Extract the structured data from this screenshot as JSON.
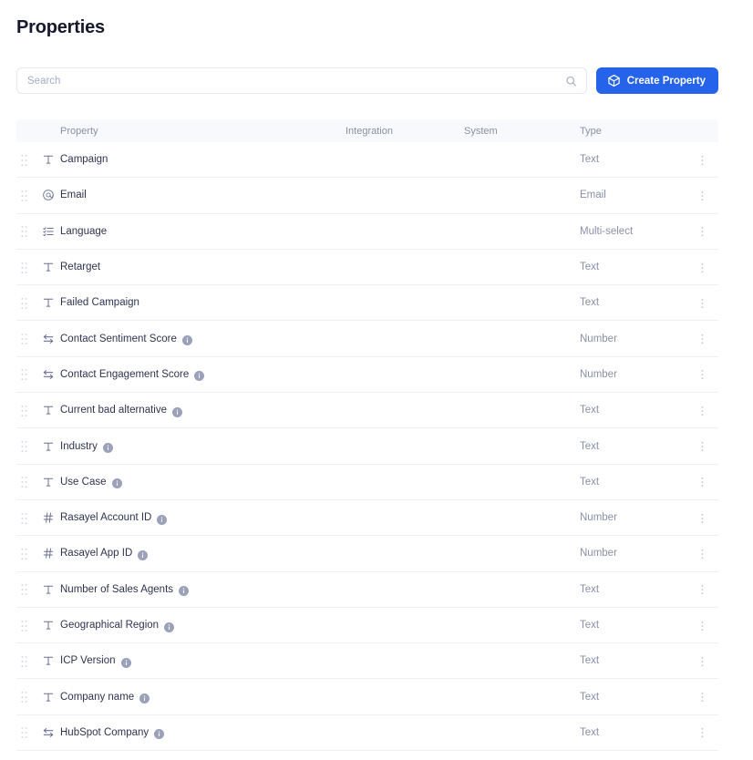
{
  "page": {
    "title": "Properties"
  },
  "toolbar": {
    "search_placeholder": "Search",
    "search_value": "",
    "search_icon": "search-icon",
    "create_label": "Create Property",
    "create_icon": "cube-icon",
    "accent_color": "#2563eb"
  },
  "table": {
    "columns": [
      "Property",
      "Integration",
      "System",
      "Type"
    ],
    "header_bg": "#f8f9fc",
    "rows": [
      {
        "icon": "text-icon",
        "name": "Campaign",
        "info": false,
        "integration": "",
        "system": "",
        "type": "Text"
      },
      {
        "icon": "email-icon",
        "name": "Email",
        "info": false,
        "integration": "",
        "system": "",
        "type": "Email"
      },
      {
        "icon": "list-icon",
        "name": "Language",
        "info": false,
        "integration": "",
        "system": "",
        "type": "Multi-select"
      },
      {
        "icon": "text-icon",
        "name": "Retarget",
        "info": false,
        "integration": "",
        "system": "",
        "type": "Text"
      },
      {
        "icon": "text-icon",
        "name": "Failed Campaign",
        "info": false,
        "integration": "",
        "system": "",
        "type": "Text"
      },
      {
        "icon": "relation-icon",
        "name": "Contact Sentiment Score",
        "info": true,
        "integration": "",
        "system": "",
        "type": "Number"
      },
      {
        "icon": "relation-icon",
        "name": "Contact Engagement Score",
        "info": true,
        "integration": "",
        "system": "",
        "type": "Number"
      },
      {
        "icon": "text-icon",
        "name": "Current bad alternative",
        "info": true,
        "integration": "",
        "system": "",
        "type": "Text"
      },
      {
        "icon": "text-icon",
        "name": "Industry",
        "info": true,
        "integration": "",
        "system": "",
        "type": "Text"
      },
      {
        "icon": "text-icon",
        "name": "Use Case",
        "info": true,
        "integration": "",
        "system": "",
        "type": "Text"
      },
      {
        "icon": "number-icon",
        "name": "Rasayel Account ID",
        "info": true,
        "integration": "",
        "system": "",
        "type": "Number"
      },
      {
        "icon": "number-icon",
        "name": "Rasayel App ID",
        "info": true,
        "integration": "",
        "system": "",
        "type": "Number"
      },
      {
        "icon": "text-icon",
        "name": "Number of Sales Agents",
        "info": true,
        "integration": "",
        "system": "",
        "type": "Text"
      },
      {
        "icon": "text-icon",
        "name": "Geographical Region",
        "info": true,
        "integration": "",
        "system": "",
        "type": "Text"
      },
      {
        "icon": "text-icon",
        "name": "ICP Version",
        "info": true,
        "integration": "",
        "system": "",
        "type": "Text"
      },
      {
        "icon": "text-icon",
        "name": "Company name",
        "info": true,
        "integration": "",
        "system": "",
        "type": "Text"
      },
      {
        "icon": "relation-icon",
        "name": "HubSpot Company",
        "info": true,
        "integration": "",
        "system": "",
        "type": "Text"
      }
    ]
  }
}
